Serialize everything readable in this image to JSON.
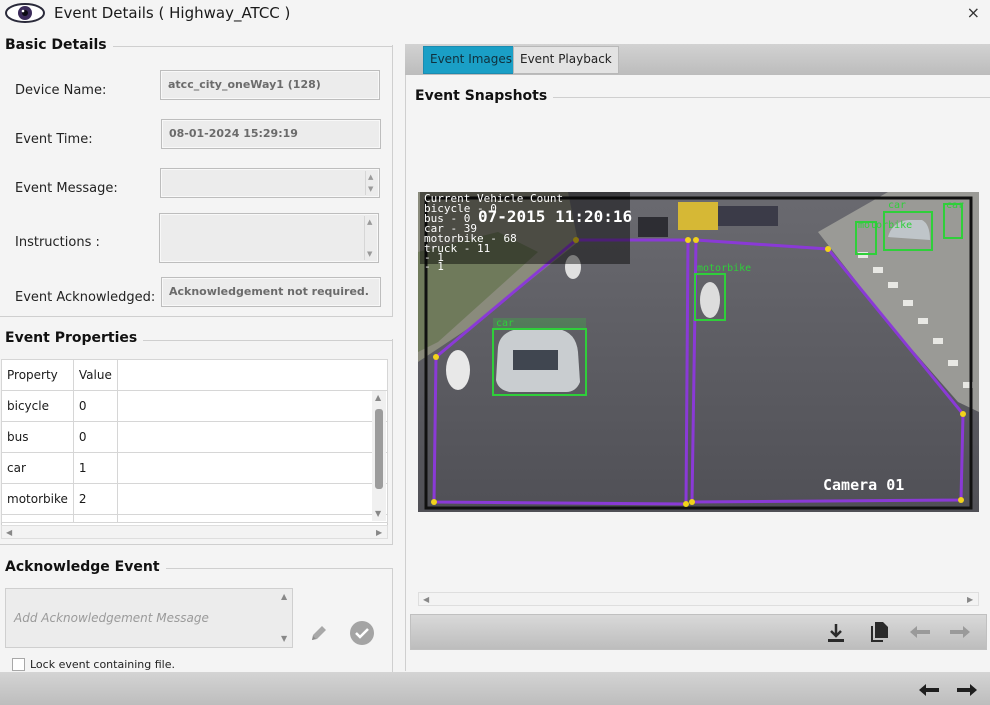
{
  "window": {
    "title": "Event Details ( Highway_ATCC )",
    "close_glyph": "×"
  },
  "basic_details": {
    "section_title": "Basic Details",
    "device_name_label": "Device Name:",
    "device_name_value": "atcc_city_oneWay1 (128)",
    "event_time_label": "Event Time:",
    "event_time_value": "08-01-2024 15:29:19",
    "event_message_label": "Event Message:",
    "event_message_value": "",
    "instructions_label": "Instructions :",
    "instructions_value": "",
    "event_ack_label": "Event Acknowledged:",
    "event_ack_value": "Acknowledgement not required."
  },
  "event_properties": {
    "section_title": "Event Properties",
    "columns": [
      "Property",
      "Value"
    ],
    "rows": [
      {
        "property": "bicycle",
        "value": "0"
      },
      {
        "property": "bus",
        "value": "0"
      },
      {
        "property": "car",
        "value": "1"
      },
      {
        "property": "motorbike",
        "value": "2"
      }
    ]
  },
  "acknowledge_event": {
    "section_title": "Acknowledge Event",
    "message_placeholder": "Add Acknowledgement Message",
    "lock_label": "Lock event containing file."
  },
  "tabs": [
    {
      "label": "Event Images",
      "active": true
    },
    {
      "label": "Event Playback",
      "active": false
    }
  ],
  "snapshots": {
    "section_title": "Event Snapshots",
    "overlay_lines": [
      "Current Vehicle Count",
      "bicycle - 0",
      "bus - 0",
      "car - 39",
      "motorbike - 68",
      "truck - 11",
      "- 1",
      "- 1"
    ],
    "timestamp": "07-2015 11:20:16",
    "camera_label": "Camera 01",
    "detections": [
      "car",
      "car",
      "motorbike",
      "motorbike",
      "car"
    ]
  },
  "icons": {
    "app": "eye-icon",
    "edit": "pencil-icon",
    "confirm": "checkmark-circle-icon",
    "download": "download-icon",
    "copy": "copy-icon",
    "prev": "arrow-left-icon",
    "next": "arrow-right-icon"
  },
  "colors": {
    "active_tab": "#1a9fc6",
    "zone_line": "#8a3ad6",
    "detection_box": "#2fcf3a",
    "zone_point": "#f2d21b"
  }
}
